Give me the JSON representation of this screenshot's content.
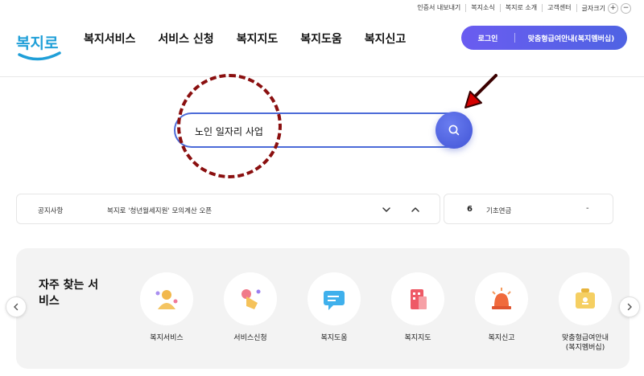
{
  "utility": {
    "items": [
      "인증서 내보내기",
      "복지소식",
      "복지로 소개",
      "고객센터"
    ],
    "font_size_label": "글자크기",
    "plus": "+",
    "minus": "−"
  },
  "header": {
    "logo_text": "복지로",
    "nav": [
      "복지서비스",
      "서비스 신청",
      "복지지도",
      "복지도움",
      "복지신고"
    ],
    "login_label": "로그인",
    "membership_label": "맞춤형급여안내(복지멤버십)"
  },
  "search": {
    "value": "노인 일자리 사업",
    "icon": "search-icon"
  },
  "notice": {
    "label": "공지사항",
    "text": "복지로 '청년월세지원' 모의계산 오픈"
  },
  "ranking": {
    "number": "6",
    "text": "기초연금",
    "change": "-"
  },
  "services": {
    "title": "자주 찾는 서비스",
    "items": [
      {
        "label": "복지서비스",
        "icon": "person-icon"
      },
      {
        "label": "서비스신청",
        "icon": "hand-click-icon"
      },
      {
        "label": "복지도움",
        "icon": "chat-icon"
      },
      {
        "label": "복지지도",
        "icon": "building-icon"
      },
      {
        "label": "복지신고",
        "icon": "siren-icon"
      },
      {
        "label": "맞춤형급여안내\n(복지멤버십)",
        "icon": "briefcase-icon"
      }
    ]
  },
  "colors": {
    "accent": "#5b63e6",
    "annotation": "#8a0f0f",
    "arrow": "#d40000"
  }
}
